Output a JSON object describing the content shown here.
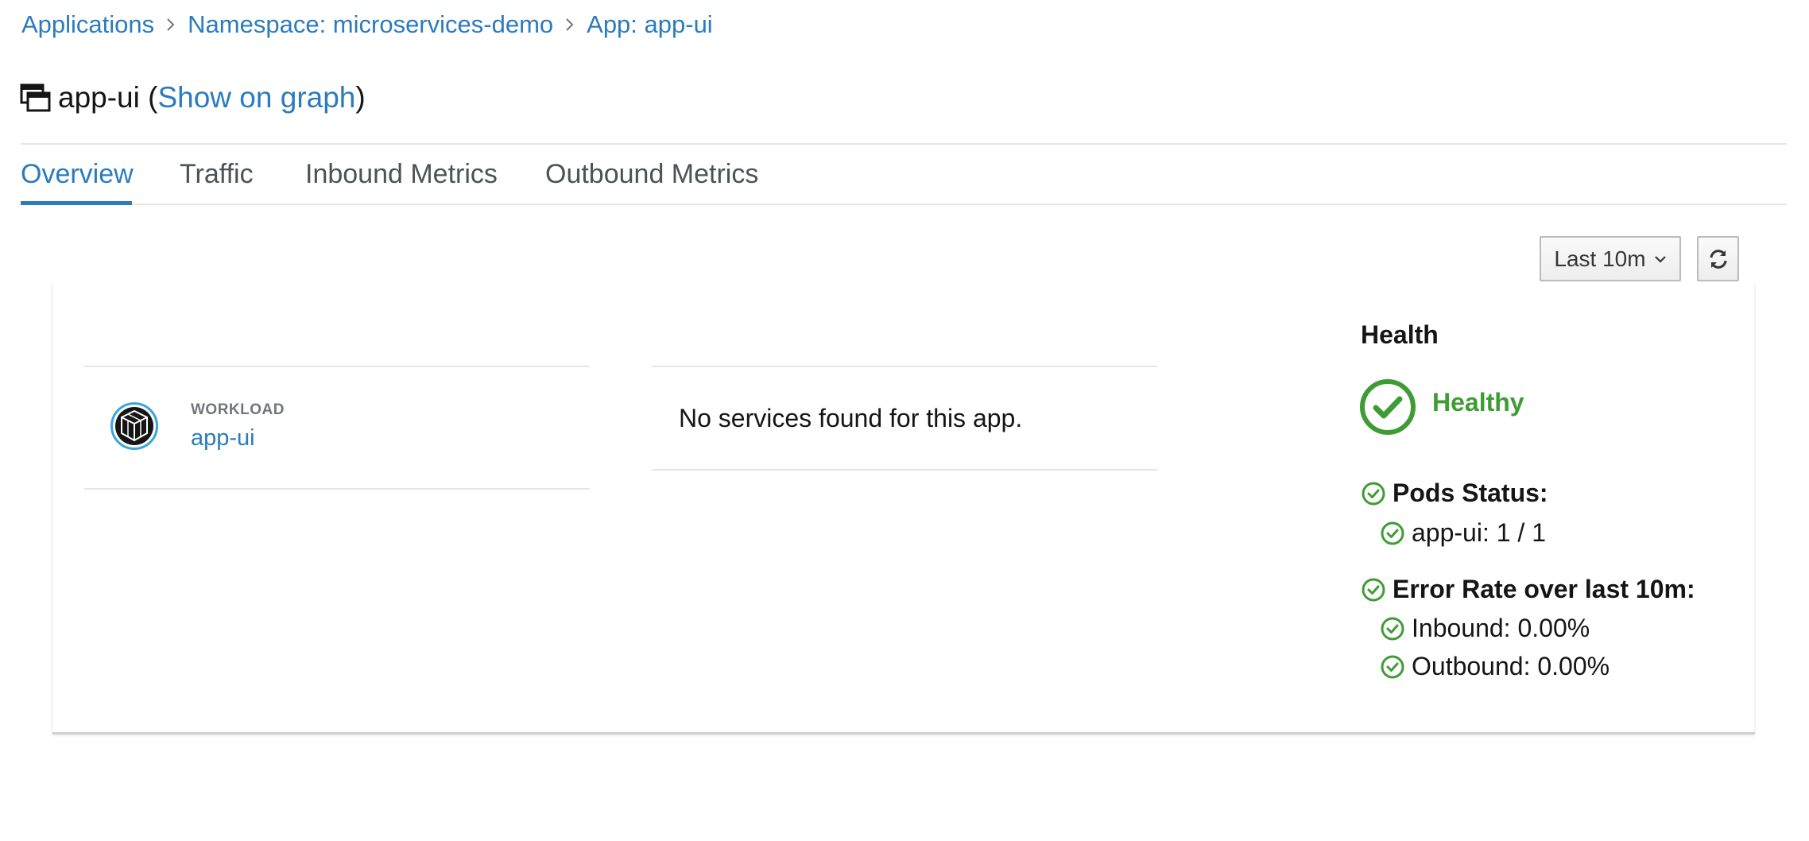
{
  "breadcrumb": {
    "items": [
      "Applications",
      "Namespace: microservices-demo",
      "App: app-ui"
    ]
  },
  "title": {
    "name": "app-ui",
    "open_paren": "(",
    "link_label": "Show on graph",
    "close_paren": ")"
  },
  "tabs": [
    {
      "label": "Overview",
      "active": true
    },
    {
      "label": "Traffic",
      "active": false
    },
    {
      "label": "Inbound Metrics",
      "active": false
    },
    {
      "label": "Outbound Metrics",
      "active": false
    }
  ],
  "toolbar": {
    "duration_label": "Last 10m",
    "icons": {
      "dropdown": "chevron-down-icon",
      "refresh": "refresh-icon"
    }
  },
  "workload": {
    "type_label": "WORKLOAD",
    "name": "app-ui",
    "icon": "workload-cube-icon"
  },
  "services": {
    "empty_message": "No services found for this app."
  },
  "health": {
    "title": "Health",
    "status": "Healthy",
    "status_color": "#3f9c35",
    "pods_status_label": "Pods Status:",
    "pods": [
      {
        "label": "app-ui: 1 / 1"
      }
    ],
    "error_rate_label": "Error Rate over last 10m:",
    "inbound": "Inbound: 0.00%",
    "outbound": "Outbound: 0.00%"
  },
  "colors": {
    "link": "#2b7bbd",
    "ok": "#3f9c35",
    "divider": "#e6e6e6"
  }
}
